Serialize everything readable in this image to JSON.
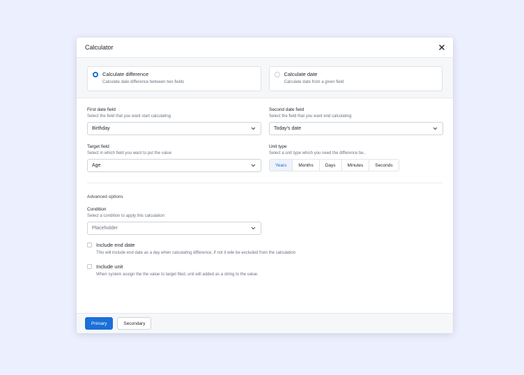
{
  "modal": {
    "title": "Calculator",
    "close_icon": "close-icon"
  },
  "mode": {
    "options": [
      {
        "title": "Calculate difference",
        "description": "Calculate date difference between two fields",
        "selected": true
      },
      {
        "title": "Calculate date",
        "description": "Calculate date from a given field",
        "selected": false
      }
    ]
  },
  "fields": {
    "first_date": {
      "label": "First date field",
      "help": "Select the field that you want start calculating",
      "value": "Birthday"
    },
    "second_date": {
      "label": "Second date field",
      "help": "Select the field that you want end calculating",
      "value": "Today's date"
    },
    "target": {
      "label": "Target field",
      "help": "Select in which field you want to put the value",
      "value": "Age"
    },
    "unit_type": {
      "label": "Unit type",
      "help": "Select a unit type which you need the difference be..",
      "options": [
        "Years",
        "Months",
        "Days",
        "Minutes",
        "Seconds"
      ],
      "selected": "Years"
    }
  },
  "advanced": {
    "title": "Advanced options",
    "condition": {
      "label": "Condition",
      "help": "Select a condition to apply this calculation",
      "placeholder": "Placeholder"
    },
    "include_end_date": {
      "label": "Include end date",
      "description": "This will include end date as a day when calculating difference, if not it wile be excluded from the calculation",
      "checked": false
    },
    "include_unit": {
      "label": "Include unit",
      "description": "When system assign the the value to target filed, unit will added as a string to the value.",
      "checked": false
    }
  },
  "footer": {
    "primary_label": "Primary",
    "secondary_label": "Secondary"
  },
  "colors": {
    "accent": "#1b6fd8",
    "background": "#eceffd"
  }
}
